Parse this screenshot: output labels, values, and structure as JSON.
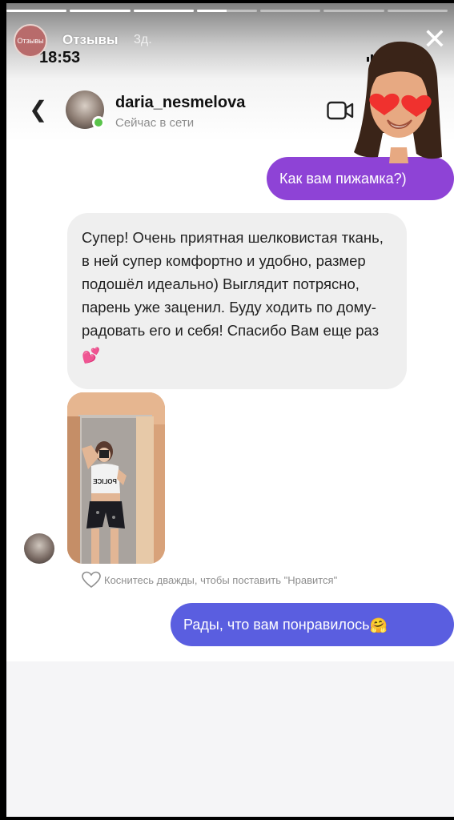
{
  "story": {
    "account_name": "Отзывы",
    "avatar_text": "Отзывы",
    "time_ago": "3д.",
    "progress": [
      1,
      1,
      1,
      0.5,
      0,
      0,
      0
    ]
  },
  "status_bar": {
    "time": "18:53"
  },
  "dm": {
    "username": "daria_nesmelova",
    "status": "Сейчас в сети"
  },
  "messages": {
    "outgoing_1": "Как вам пижамка?)",
    "incoming_text": "Супер! Очень приятная шелковистая ткань, в ней супер комфортно и удобно, размер подошёл идеально) Выглядит потрясно, парень уже заценил. Буду ходить по дому- радовать его и себя! Спасибо Вам еще раз",
    "incoming_emoji": "💕",
    "photo_shirt_text": "POLICE",
    "like_hint": "Коснитесь дважды, чтобы поставить \"Нравится\"",
    "outgoing_2": "Рады, что вам понравилось",
    "outgoing_2_emoji": "🤗"
  },
  "colors": {
    "outgoing_purple": "#8e43d6",
    "outgoing_blue": "#5a5ee0",
    "incoming_gray": "#efefef",
    "online_green": "#59c34a"
  }
}
